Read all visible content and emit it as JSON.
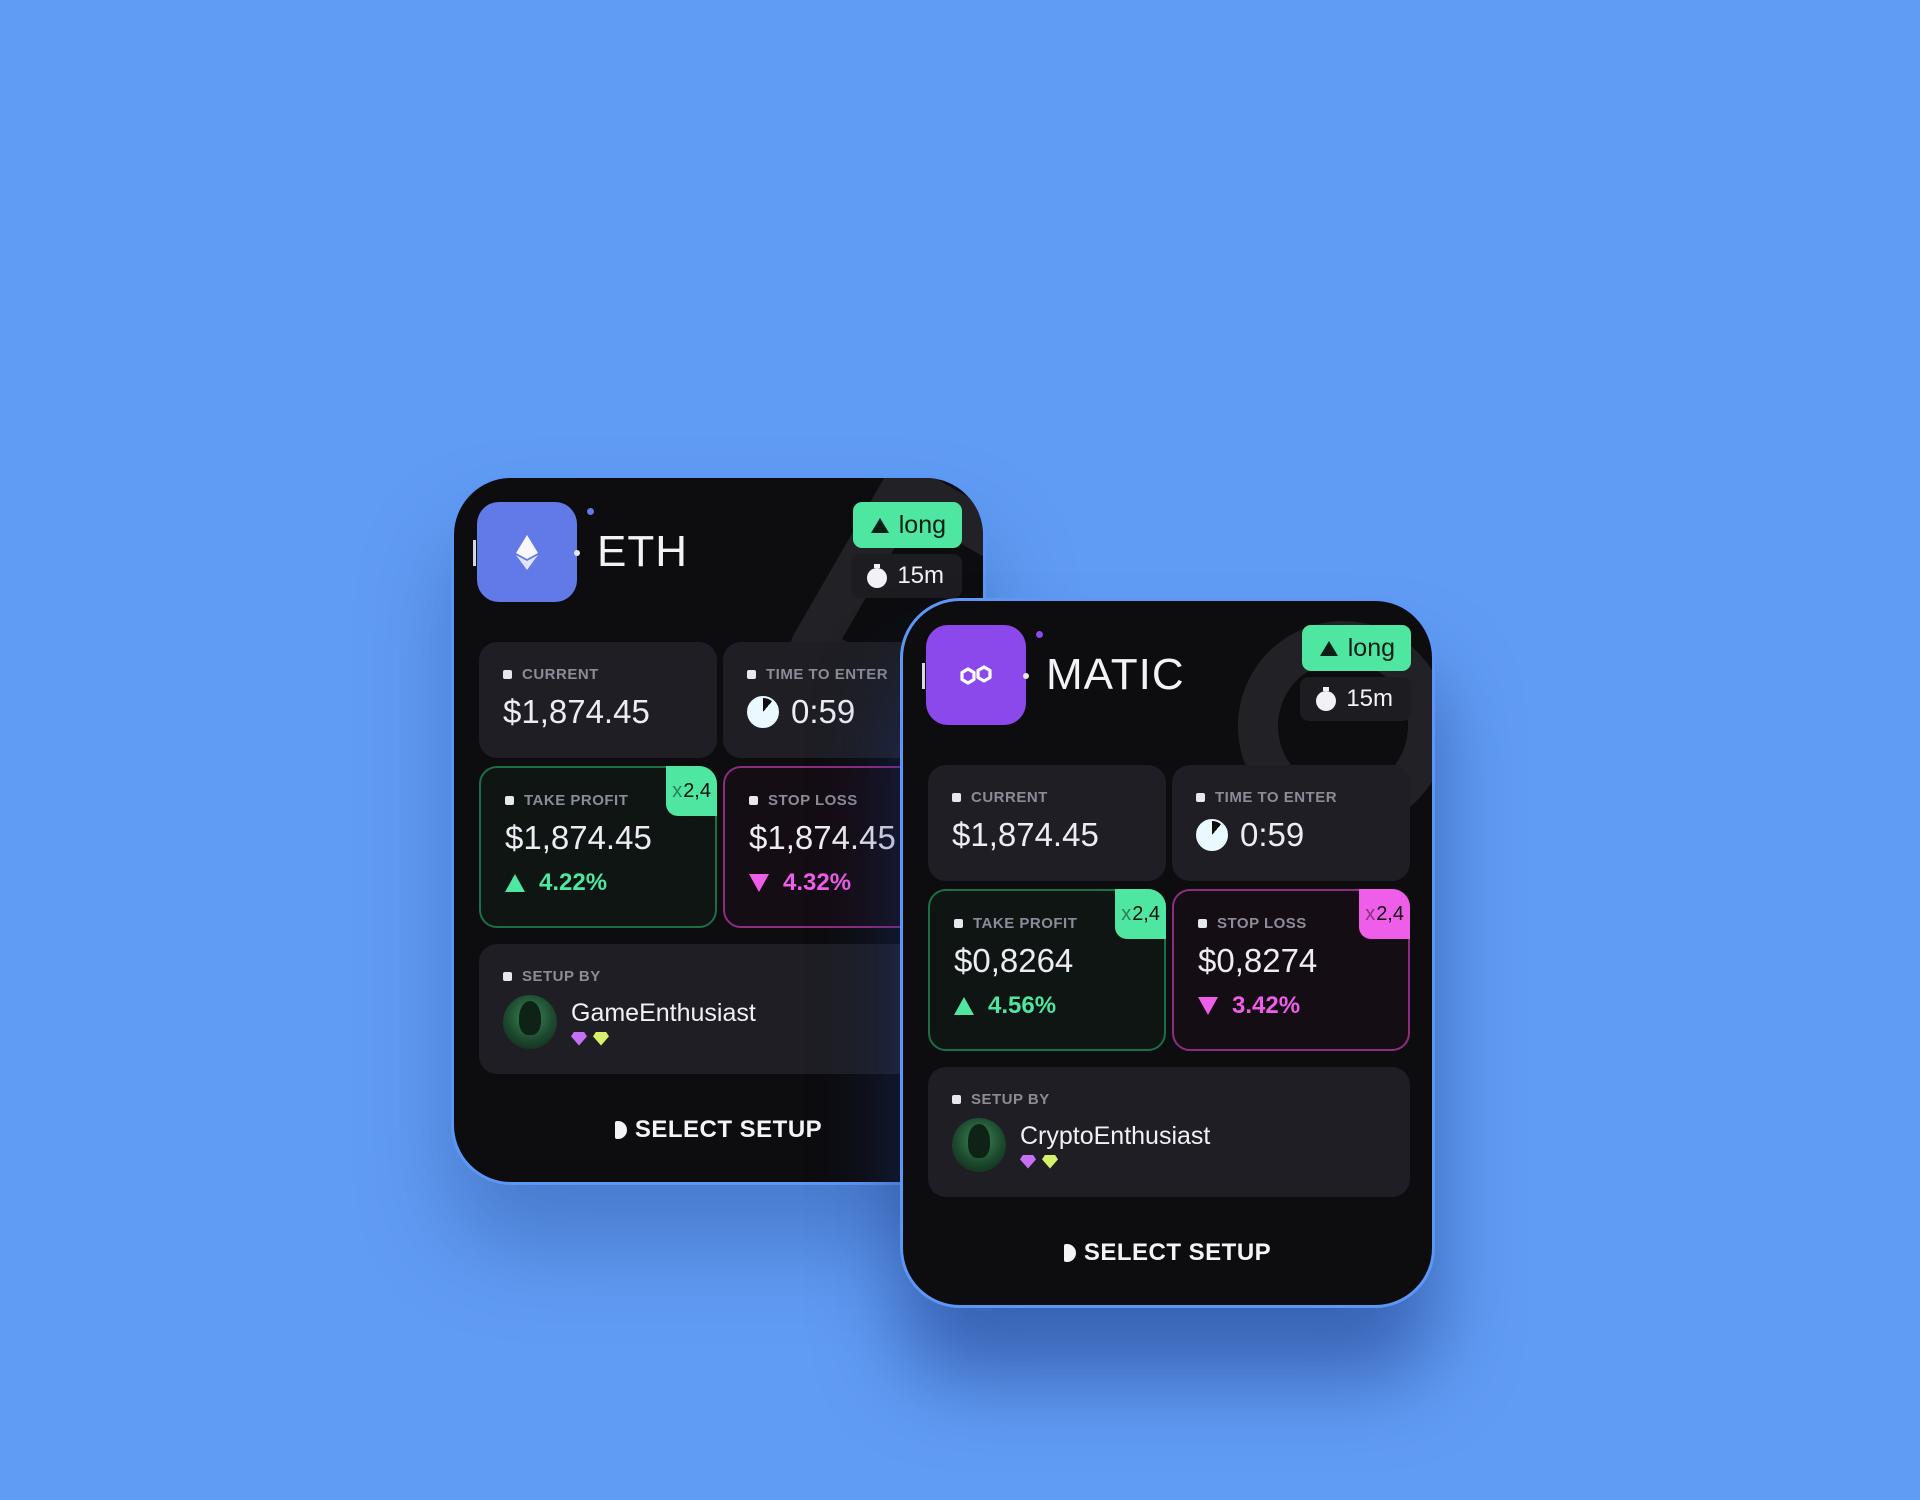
{
  "cards": [
    {
      "coin": "ETH",
      "direction": "long",
      "timeframe": "15m",
      "current_label": "CURRENT",
      "current_value": "$1,874.45",
      "time_label": "TIME TO ENTER",
      "time_value": "0:59",
      "tp_label": "TAKE PROFIT",
      "tp_mult_x": "x",
      "tp_mult": "2,4",
      "tp_value": "$1,874.45",
      "tp_pct": "4.22%",
      "sl_label": "STOP LOSS",
      "sl_value": "$1,874.45",
      "sl_pct": "4.32%",
      "setup_label": "SETUP BY",
      "user": "GameEnthusiast",
      "select_label": "SELECT SETUP"
    },
    {
      "coin": "MATIC",
      "direction": "long",
      "timeframe": "15m",
      "current_label": "CURRENT",
      "current_value": "$1,874.45",
      "time_label": "TIME TO ENTER",
      "time_value": "0:59",
      "tp_label": "TAKE PROFIT",
      "tp_mult_x": "x",
      "tp_mult": "2,4",
      "tp_value": "$0,8264",
      "tp_pct": "4.56%",
      "sl_label": "STOP LOSS",
      "sl_mult_x": "x",
      "sl_mult": "2,4",
      "sl_value": "$0,8274",
      "sl_pct": "3.42%",
      "setup_label": "SETUP BY",
      "user": "CryptoEnthusiast",
      "select_label": "SELECT SETUP"
    }
  ],
  "colors": {
    "background": "#619cf4",
    "card": "#0d0d10",
    "tile": "#1e1e24",
    "long_green": "#4ee6a0",
    "loss_pink": "#ef5ee8",
    "eth_icon": "#6279e8",
    "matic_icon": "#8b48ea"
  },
  "icons": {
    "coin_eth": "ethereum-icon",
    "coin_matic": "polygon-icon",
    "direction": "triangle-up-icon",
    "timeframe": "stopwatch-icon",
    "timer": "pie-timer-icon",
    "gain": "triangle-up-icon",
    "loss": "triangle-down-icon",
    "select": "play-icon",
    "badges": "gem-icon"
  }
}
